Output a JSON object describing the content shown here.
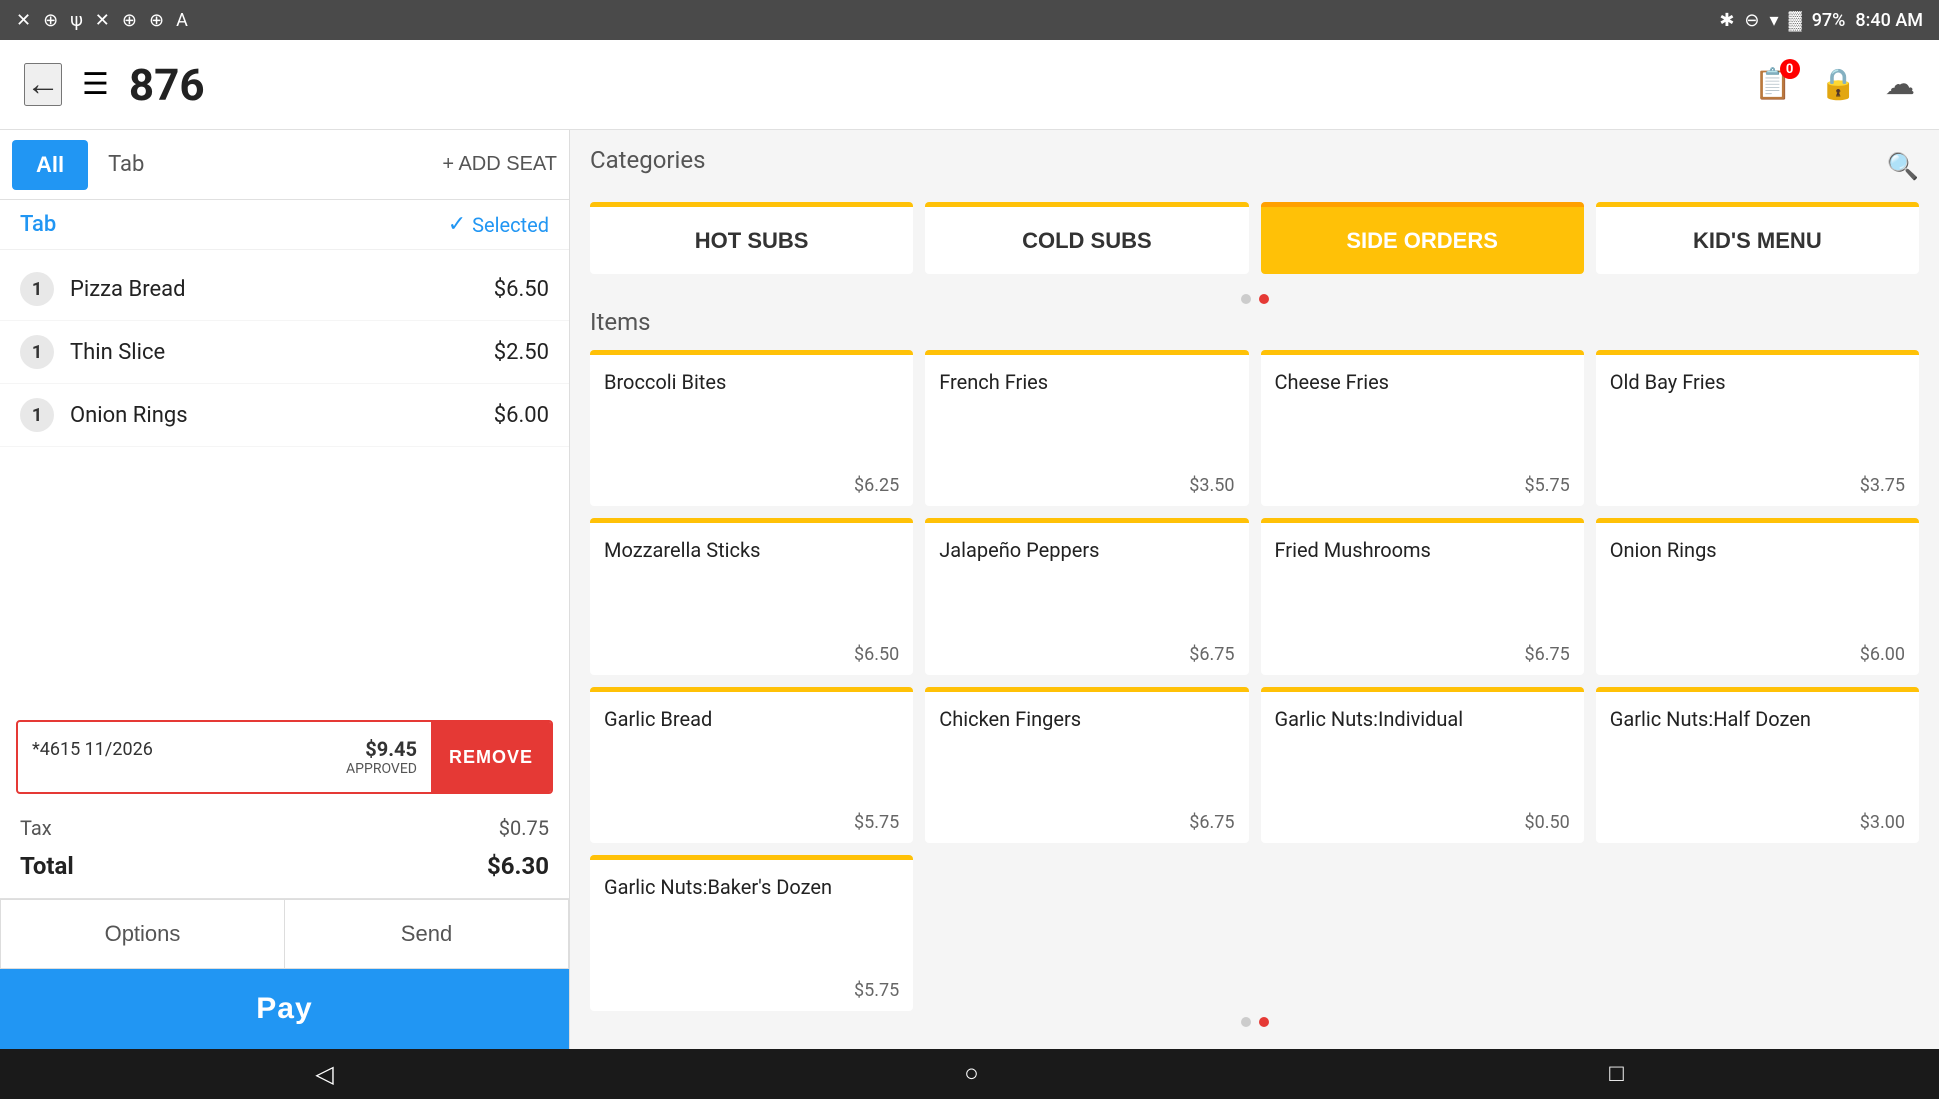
{
  "statusBar": {
    "time": "8:40 AM",
    "battery": "97%",
    "icons": [
      "×",
      "⊕",
      "⊕",
      "×",
      "⊕",
      "⊕",
      "A"
    ]
  },
  "topBar": {
    "orderNumber": "876",
    "notificationCount": "0"
  },
  "seatBar": {
    "allLabel": "All",
    "tabLabel": "Tab",
    "addSeatLabel": "+ ADD SEAT"
  },
  "tabSection": {
    "tabTitle": "Tab",
    "selectedLabel": "Selected"
  },
  "orderItems": [
    {
      "qty": "1",
      "name": "Pizza Bread",
      "price": "$6.50"
    },
    {
      "qty": "1",
      "name": "Thin Slice",
      "price": "$2.50"
    },
    {
      "qty": "1",
      "name": "Onion Rings",
      "price": "$6.00"
    }
  ],
  "payment": {
    "card": "*4615 11/2026",
    "amount": "$9.45",
    "status": "APPROVED",
    "removeLabel": "REMOVE"
  },
  "totals": {
    "taxLabel": "Tax",
    "taxAmount": "$0.75",
    "totalLabel": "Total",
    "totalAmount": "$6.30"
  },
  "actions": {
    "optionsLabel": "Options",
    "sendLabel": "Send",
    "payLabel": "Pay"
  },
  "categories": {
    "title": "Categories",
    "items": [
      {
        "label": "HOT SUBS",
        "active": false
      },
      {
        "label": "COLD SUBS",
        "active": false
      },
      {
        "label": "SIDE ORDERS",
        "active": true
      },
      {
        "label": "KID'S MENU",
        "active": false
      }
    ]
  },
  "itemsSection": {
    "title": "Items",
    "items": [
      {
        "name": "Broccoli Bites",
        "price": "$6.25"
      },
      {
        "name": "French Fries",
        "price": "$3.50"
      },
      {
        "name": "Cheese Fries",
        "price": "$5.75"
      },
      {
        "name": "Old Bay Fries",
        "price": "$3.75"
      },
      {
        "name": "Mozzarella Sticks",
        "price": "$6.50"
      },
      {
        "name": "Jalapeño Peppers",
        "price": "$6.75"
      },
      {
        "name": "Fried Mushrooms",
        "price": "$6.75"
      },
      {
        "name": "Onion Rings",
        "price": "$6.00"
      },
      {
        "name": "Garlic Bread",
        "price": "$5.75"
      },
      {
        "name": "Chicken Fingers",
        "price": "$6.75"
      },
      {
        "name": "Garlic Nuts:Individual",
        "price": "$0.50"
      },
      {
        "name": "Garlic Nuts:Half Dozen",
        "price": "$3.00"
      },
      {
        "name": "Garlic Nuts:Baker's Dozen",
        "price": "$5.75"
      }
    ]
  },
  "bottomNav": {
    "backLabel": "◁",
    "homeLabel": "○",
    "squareLabel": "□"
  }
}
